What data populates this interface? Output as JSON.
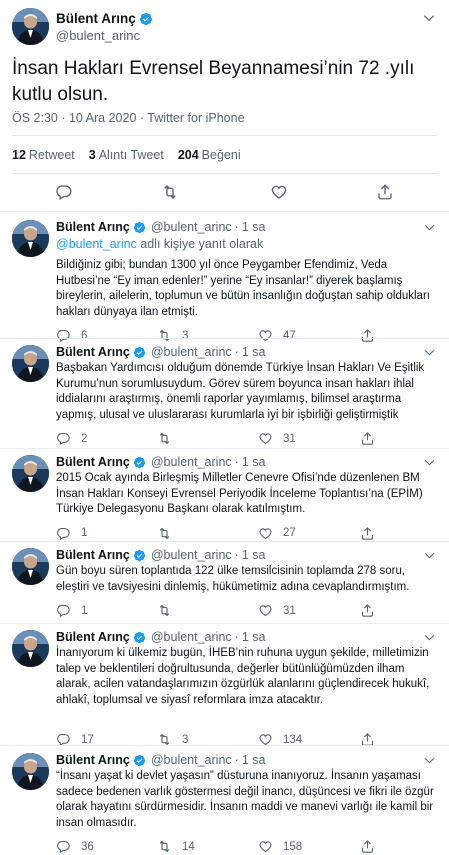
{
  "colors": {
    "accent": "#1d9bf0",
    "muted": "#536471",
    "text": "#0f1419",
    "border": "#e6ecf0"
  },
  "main_tweet": {
    "author_name": "Bülent Arınç",
    "author_handle": "@bulent_arinc",
    "text": "İnsan Hakları Evrensel Beyannamesi’nin 72 .yılı kutlu olsun.",
    "meta": "ÖS 2:30 · 10 Ara 2020 · Twitter for iPhone",
    "stats": [
      {
        "count": "12",
        "label": "Retweet"
      },
      {
        "count": "3",
        "label": "Alıntı Tweet"
      },
      {
        "count": "204",
        "label": "Beğeni"
      }
    ]
  },
  "replies": [
    {
      "author_name": "Bülent Arınç",
      "author_handle": "@bulent_arinc",
      "time": "1 sa",
      "reply_mention": "@bulent_arinc",
      "reply_suffix": " adlı kişiye yanıt olarak",
      "text": "Bildiğiniz gibi; bundan 1300 yıl önce Peygamber Efendimiz, Veda Hutbesi’ne “Ey iman edenler!” yerine “Ey insanlar!” diyerek başlamış bireylerin, ailelerin, toplumun ve bütün insanlığın doğuştan sahip oldukları hakları dünyaya ilan etmişti.",
      "replies": "6",
      "retweets": "3",
      "likes": "47"
    },
    {
      "author_name": "Bülent Arınç",
      "author_handle": "@bulent_arinc",
      "time": "1 sa",
      "text": "Başbakan Yardımcısı olduğum dönemde Türkiye İnsan Hakları Ve Eşitlik Kurumu’nun sorumlusuydum. Görev sürem boyunca insan hakları ihlal iddialarını araştırmış, önemli raporlar yayımlamış, bilimsel araştırma yapmış, ulusal ve uluslararası kurumlarla iyi bir işbirliği geliştirmiştik",
      "replies": "2",
      "retweets": "",
      "likes": "31"
    },
    {
      "author_name": "Bülent Arınç",
      "author_handle": "@bulent_arinc",
      "time": "1 sa",
      "text": "2015 Ocak ayında Birleşmiş Milletler Cenevre Ofisi’nde düzenlenen BM İnsan Hakları Konseyi Evrensel Periyodik İnceleme Toplantısı’na (EPİM) Türkiye Delegasyonu Başkanı olarak katılmıştım.",
      "replies": "1",
      "retweets": "",
      "likes": "27"
    },
    {
      "author_name": "Bülent Arınç",
      "author_handle": "@bulent_arinc",
      "time": "1 sa",
      "text": "Gün boyu süren toplantıda 122 ülke temsilcisinin toplamda 278 soru, eleştiri ve tavsiyesini dinlemiş, hükümetimiz adına cevaplandırmıştım.",
      "replies": "1",
      "retweets": "",
      "likes": "31"
    },
    {
      "author_name": "Bülent Arınç",
      "author_handle": "@bulent_arinc",
      "time": "1 sa",
      "text": "İnanıyorum ki ülkemiz bugün, İHEB’nin ruhuna uygun şekilde, milletimizin talep ve beklentileri doğrultusunda, değerler bütünlüğümüzden ilham alarak, acilen vatandaşlarımızın özgürlük alanlarını güçlendirecek hukukî, ahlakî, toplumsal ve siyasî reformlara imza atacaktır.",
      "replies": "17",
      "retweets": "3",
      "likes": "134"
    },
    {
      "author_name": "Bülent Arınç",
      "author_handle": "@bulent_arinc",
      "time": "1 sa",
      "text": "“İnsanı yaşat ki devlet yaşasın” düsturuna inanıyoruz. İnsanın yaşaması sadece bedenen varlık göstermesi değil inancı, düşüncesi ve fikri ile özgür olarak hayatını sürdürmesidir. İnsanın maddi ve manevi varlığı ile kamil bir insan olmasıdır.",
      "replies": "36",
      "retweets": "14",
      "likes": "158"
    }
  ]
}
